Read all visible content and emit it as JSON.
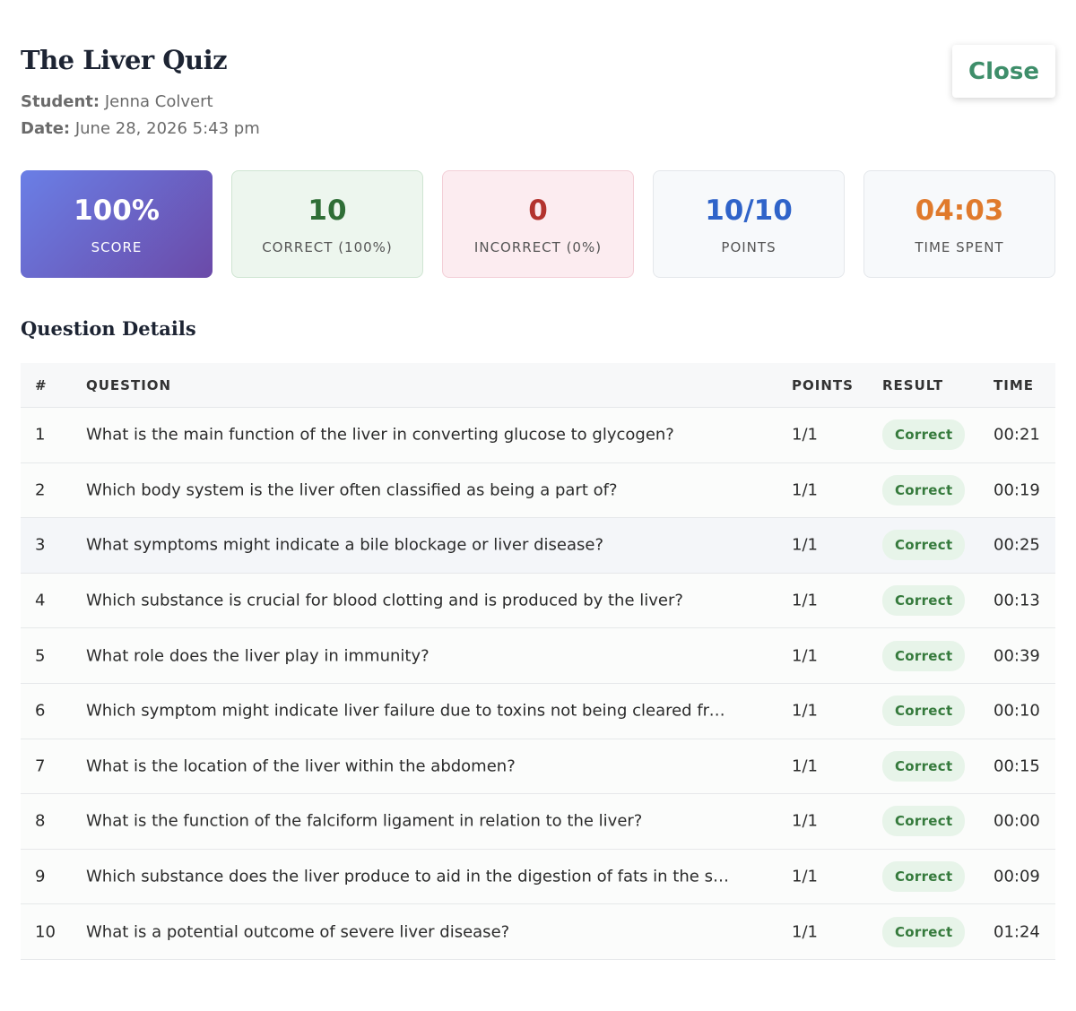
{
  "header": {
    "title": "The Liver Quiz",
    "student_label": "Student:",
    "student_name": "Jenna Colvert",
    "date_label": "Date:",
    "date_value": "June 28, 2026 5:43 pm",
    "close_label": "Close"
  },
  "stats": {
    "score": {
      "value": "100%",
      "label": "SCORE"
    },
    "correct": {
      "value": "10",
      "label": "CORRECT (100%)"
    },
    "incorrect": {
      "value": "0",
      "label": "INCORRECT (0%)"
    },
    "points": {
      "value": "10/10",
      "label": "POINTS"
    },
    "time": {
      "value": "04:03",
      "label": "TIME SPENT"
    }
  },
  "section_title": "Question Details",
  "table": {
    "columns": [
      "#",
      "QUESTION",
      "POINTS",
      "RESULT",
      "TIME"
    ],
    "rows": [
      {
        "num": "1",
        "question": "What is the main function of the liver in converting glucose to glycogen?",
        "points": "1/1",
        "result": "Correct",
        "time": "00:21"
      },
      {
        "num": "2",
        "question": "Which body system is the liver often classified as being a part of?",
        "points": "1/1",
        "result": "Correct",
        "time": "00:19"
      },
      {
        "num": "3",
        "question": "What symptoms might indicate a bile blockage or liver disease?",
        "points": "1/1",
        "result": "Correct",
        "time": "00:25"
      },
      {
        "num": "4",
        "question": "Which substance is crucial for blood clotting and is produced by the liver?",
        "points": "1/1",
        "result": "Correct",
        "time": "00:13"
      },
      {
        "num": "5",
        "question": "What role does the liver play in immunity?",
        "points": "1/1",
        "result": "Correct",
        "time": "00:39"
      },
      {
        "num": "6",
        "question": "Which symptom might indicate liver failure due to toxins not being cleared from ...",
        "points": "1/1",
        "result": "Correct",
        "time": "00:10"
      },
      {
        "num": "7",
        "question": "What is the location of the liver within the abdomen?",
        "points": "1/1",
        "result": "Correct",
        "time": "00:15"
      },
      {
        "num": "8",
        "question": "What is the function of the falciform ligament in relation to the liver?",
        "points": "1/1",
        "result": "Correct",
        "time": "00:00"
      },
      {
        "num": "9",
        "question": "Which substance does the liver produce to aid in the digestion of fats in the sm...",
        "points": "1/1",
        "result": "Correct",
        "time": "00:09"
      },
      {
        "num": "10",
        "question": "What is a potential outcome of severe liver disease?",
        "points": "1/1",
        "result": "Correct",
        "time": "01:24"
      }
    ]
  }
}
